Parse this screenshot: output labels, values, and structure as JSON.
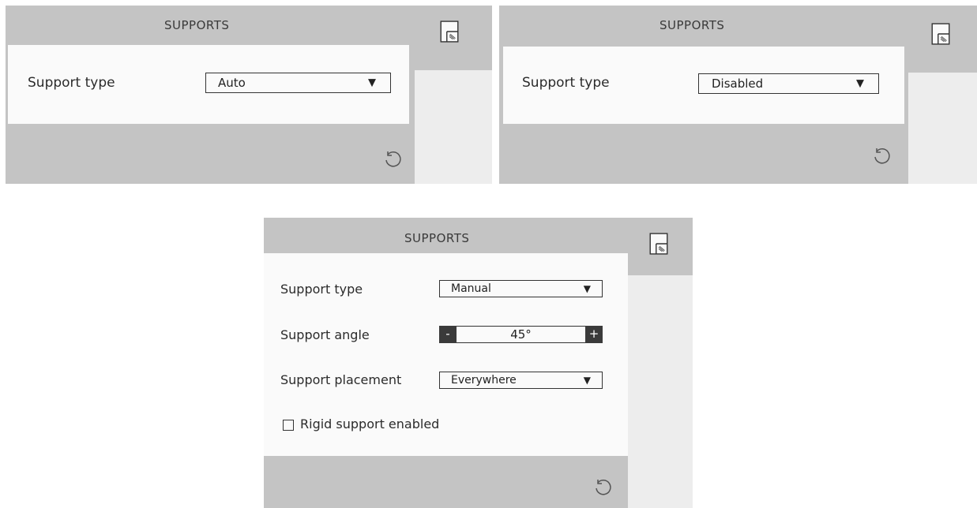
{
  "panels": [
    {
      "title": "SUPPORTS",
      "support_type_label": "Support type",
      "support_type_value": "Auto"
    },
    {
      "title": "SUPPORTS",
      "support_type_label": "Support type",
      "support_type_value": "Disabled"
    },
    {
      "title": "SUPPORTS",
      "support_type_label": "Support type",
      "support_type_value": "Manual",
      "support_angle_label": "Support angle",
      "support_angle_value": "45°",
      "support_angle_minus": "-",
      "support_angle_plus": "+",
      "support_placement_label": "Support placement",
      "support_placement_value": "Everywhere",
      "rigid_label": "Rigid support enabled",
      "rigid_checked": false
    }
  ],
  "ui": {
    "dropdown_arrow": "▼",
    "icons": {
      "panel_toggle": "layer-panel-icon",
      "reset": "reset-icon"
    }
  }
}
